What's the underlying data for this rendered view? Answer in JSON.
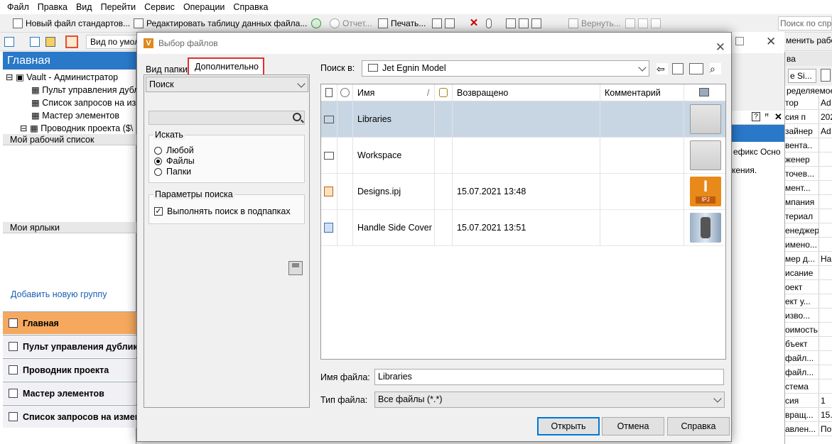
{
  "menu": [
    "Файл",
    "Правка",
    "Вид",
    "Перейти",
    "Сервис",
    "Операции",
    "Справка"
  ],
  "toolbar": {
    "new_file": "Новый файл стандартов...",
    "edit_table": "Редактировать таблицу данных файла...",
    "report": "Отчет...",
    "print": "Печать...",
    "revert": "Вернуть...",
    "search_placeholder": "Поиск по спр"
  },
  "toolbar2": {
    "view": "Вид по умол",
    "right_text": "менить работа"
  },
  "left": {
    "header": "Главная",
    "tree": [
      "Vault - Администратор",
      "Пульт управления дубл",
      "Список запросов на из",
      "Мастер элементов",
      "Проводник проекта ($\\"
    ],
    "worklist": "Мой рабочий список",
    "shortcuts": "Мои ярлыки",
    "add_group": "Добавить новую группу",
    "nav": [
      "Главная",
      "Пульт управления дублика",
      "Проводник проекта",
      "Мастер элементов",
      "Список запросов на измене"
    ]
  },
  "right": {
    "header": "ва",
    "mini": "е Si...",
    "label": "ределяемое",
    "tabs": "ефикс  Осно",
    "note": "кения.",
    "rows": [
      [
        "тор",
        "Ad"
      ],
      [
        "сия п",
        "202"
      ],
      [
        "зайнер",
        "Ad"
      ],
      [
        "вента..",
        ""
      ],
      [
        "женер",
        ""
      ],
      [
        "точев...",
        ""
      ],
      [
        "мент...",
        ""
      ],
      [
        "мпания",
        ""
      ],
      [
        "териал",
        ""
      ],
      [
        "енеджер",
        ""
      ],
      [
        "имено...",
        ""
      ],
      [
        "мер д...",
        "На"
      ],
      [
        "исание",
        ""
      ],
      [
        "оект",
        ""
      ],
      [
        "ект у...",
        ""
      ],
      [
        "изво...",
        ""
      ],
      [
        "оимость",
        ""
      ],
      [
        "бъект",
        ""
      ],
      [
        "файл...",
        ""
      ],
      [
        "файл...",
        ""
      ],
      [
        "стема",
        ""
      ],
      [
        "сия",
        "1"
      ],
      [
        "вращ...",
        "15."
      ],
      [
        "авлен...",
        "По"
      ]
    ]
  },
  "dialog": {
    "title": "Выбор файлов",
    "tab1": "Вид папки",
    "tab2": "Дополнительно",
    "search_select": "Поиск",
    "look_for": "Искать",
    "options": [
      "Любой",
      "Файлы",
      "Папки"
    ],
    "selected_option": "Файлы",
    "params": "Параметры поиска",
    "subfolders": "Выполнять поиск в подпапках",
    "look_in_label": "Поиск в:",
    "look_in_value": "Jet Egnin Model",
    "columns": [
      "Имя",
      "Возвращено",
      "Комментарий"
    ],
    "files": [
      {
        "name": "Libraries",
        "date": "",
        "type": "folder",
        "selected": true
      },
      {
        "name": "Workspace",
        "date": "",
        "type": "folder",
        "selected": false
      },
      {
        "name": "Designs.ipj",
        "date": "15.07.2021 13:48",
        "type": "ipj",
        "selected": false
      },
      {
        "name": "Handle Side Cover ...",
        "date": "15.07.2021 13:51",
        "type": "part",
        "selected": false
      }
    ],
    "ipj_badge": "IPJ",
    "filename_label": "Имя файла:",
    "filename_value": "Libraries",
    "filetype_label": "Тип файла:",
    "filetype_value": "Все файлы (*.*)",
    "btn_open": "Открыть",
    "btn_cancel": "Отмена",
    "btn_help": "Справка"
  }
}
